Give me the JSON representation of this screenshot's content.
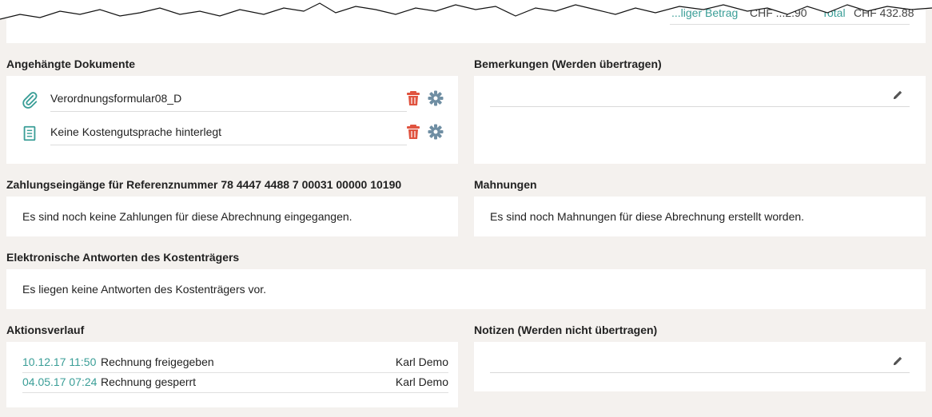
{
  "top": {
    "prev_amount_label": "...liger Betrag",
    "prev_amount_value": "CHF ...2.90",
    "total_label": "Total",
    "total_value": "CHF 432.88"
  },
  "documents": {
    "title": "Angehängte Dokumente",
    "items": [
      {
        "name": "Verordnungsformular08_D",
        "icon": "paperclip-icon"
      },
      {
        "name": "Keine Kostengutsprache hinterlegt",
        "icon": "document-icon"
      }
    ]
  },
  "remarks": {
    "title": "Bemerkungen (Werden übertragen)",
    "value": ""
  },
  "payments": {
    "title": "Zahlungseingänge für Referenznummer 78 4447 4488 7 00031 00000 10190",
    "message": "Es sind noch keine Zahlungen für diese Abrechnung eingegangen."
  },
  "reminders": {
    "title": "Mahnungen",
    "message": "Es sind noch Mahnungen für diese Abrechnung erstellt worden."
  },
  "responses": {
    "title": "Elektronische Antworten des Kostenträgers",
    "message": "Es liegen keine Antworten des Kostenträgers vor."
  },
  "actions": {
    "title": "Aktionsverlauf",
    "rows": [
      {
        "time": "10.12.17 11:50",
        "text": "Rechnung freigegeben",
        "user": "Karl Demo"
      },
      {
        "time": "04.05.17 07:24",
        "text": "Rechnung gesperrt",
        "user": "Karl Demo"
      }
    ]
  },
  "notes": {
    "title": "Notizen (Werden nicht übertragen)",
    "value": ""
  },
  "colors": {
    "accent": "#3a9e97",
    "delete": "#e0533f",
    "gear": "#6f8ea3",
    "background": "#f4f1ee"
  }
}
